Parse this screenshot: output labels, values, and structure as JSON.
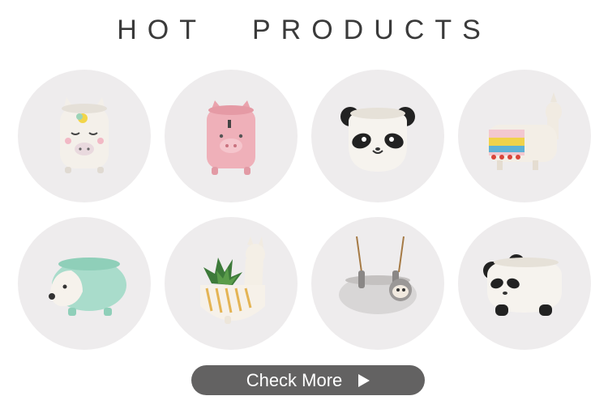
{
  "header": {
    "title_part1": "HOT",
    "title_part2": "PRODUCTS"
  },
  "products": [
    {
      "icon": "unicorn-pot-icon"
    },
    {
      "icon": "pig-pot-icon"
    },
    {
      "icon": "panda-head-pot-icon"
    },
    {
      "icon": "alpaca-pot-icon"
    },
    {
      "icon": "hedgehog-pot-icon"
    },
    {
      "icon": "llama-planter-icon"
    },
    {
      "icon": "hanging-sloth-pot-icon"
    },
    {
      "icon": "panda-body-pot-icon"
    }
  ],
  "cta": {
    "label": "Check More",
    "icon": "play-arrow-icon"
  },
  "colors": {
    "tile_bg": "#eeeced",
    "button_bg": "#636262",
    "title_text": "#3a3a3a"
  }
}
